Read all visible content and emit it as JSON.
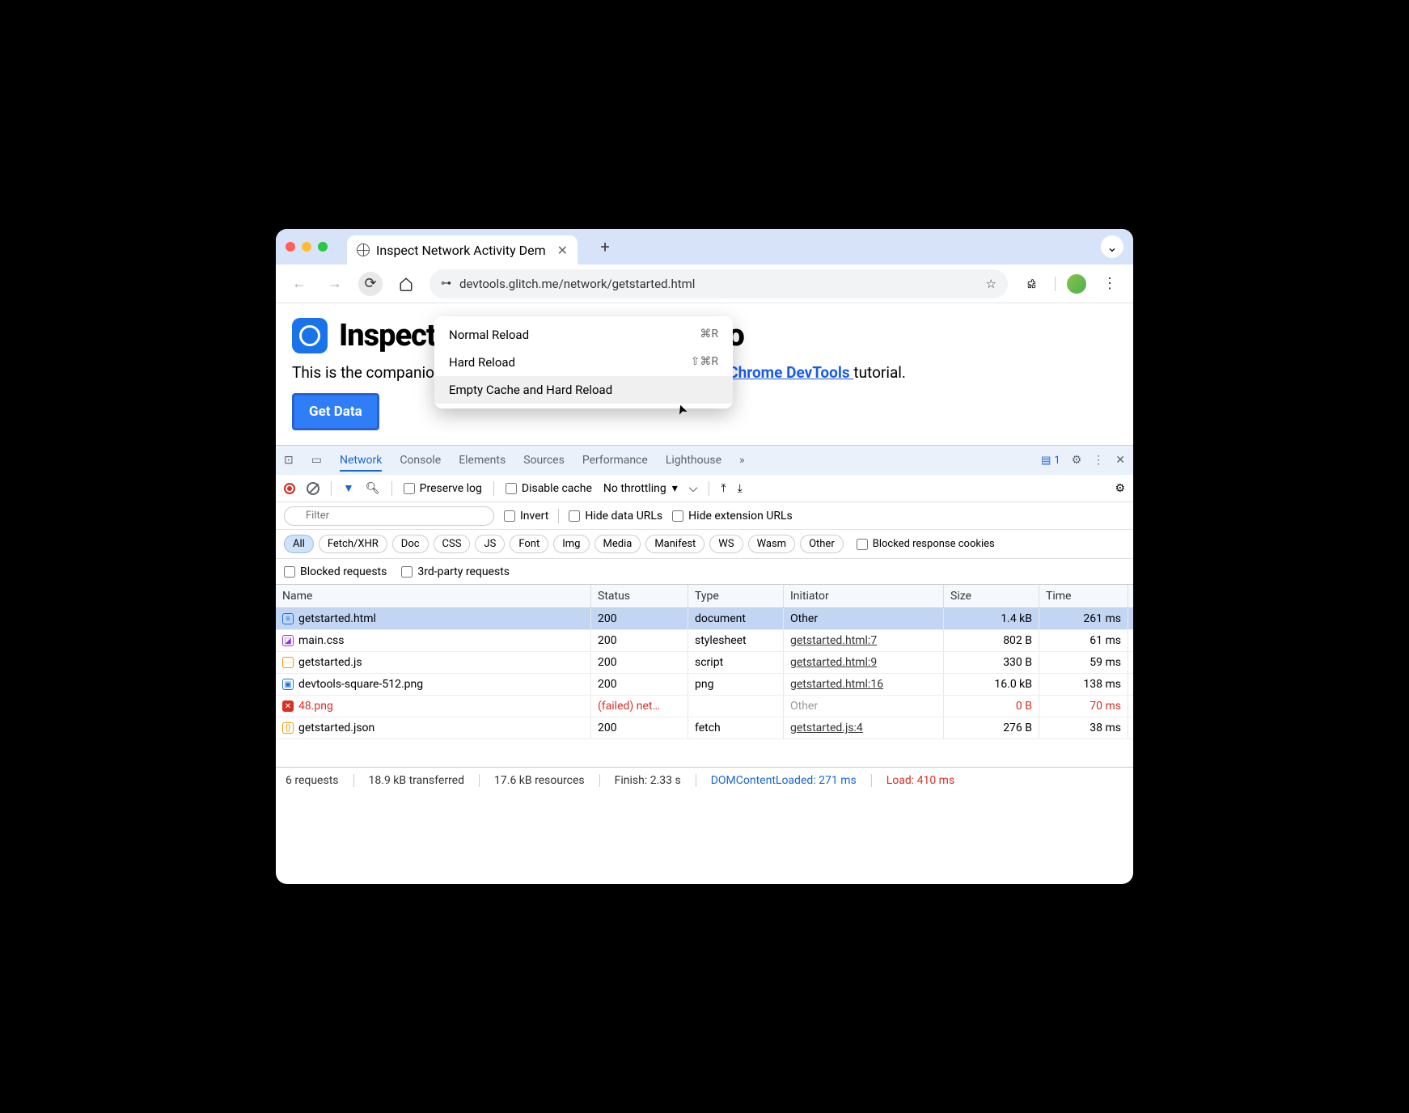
{
  "browser": {
    "tab_title": "Inspect Network Activity Dem",
    "url": "devtools.glitch.me/network/getstarted.html"
  },
  "context_menu": {
    "items": [
      {
        "label": "Normal Reload",
        "shortcut": "⌘R"
      },
      {
        "label": "Hard Reload",
        "shortcut": "⇧⌘R"
      },
      {
        "label": "Empty Cache and Hard Reload",
        "shortcut": ""
      }
    ]
  },
  "page": {
    "heading": "Inspect Network Activity Demo",
    "body_prefix": "This is the companion demo for the ",
    "link_text": "Inspect Network Activity In Chrome DevTools ",
    "body_suffix": "tutorial.",
    "button": "Get Data"
  },
  "devtools": {
    "tabs": [
      "Network",
      "Console",
      "Elements",
      "Sources",
      "Performance",
      "Lighthouse"
    ],
    "active_tab": "Network",
    "issues_count": "1",
    "controls": {
      "preserve_log": "Preserve log",
      "disable_cache": "Disable cache",
      "throttling": "No throttling"
    },
    "filter": {
      "placeholder": "Filter",
      "invert": "Invert",
      "hide_data": "Hide data URLs",
      "hide_ext": "Hide extension URLs"
    },
    "type_pills": [
      "All",
      "Fetch/XHR",
      "Doc",
      "CSS",
      "JS",
      "Font",
      "Img",
      "Media",
      "Manifest",
      "WS",
      "Wasm",
      "Other"
    ],
    "blocked_cookies": "Blocked response cookies",
    "blocked_requests": "Blocked requests",
    "third_party": "3rd-party requests",
    "columns": [
      "Name",
      "Status",
      "Type",
      "Initiator",
      "Size",
      "Time"
    ],
    "rows": [
      {
        "icon_color": "#1a73e8",
        "icon_char": "≡",
        "name": "getstarted.html",
        "status": "200",
        "type": "document",
        "initiator": "Other",
        "initiator_link": false,
        "size": "1.4 kB",
        "time": "261 ms",
        "selected": true,
        "failed": false
      },
      {
        "icon_color": "#9334e6",
        "icon_char": "◪",
        "name": "main.css",
        "status": "200",
        "type": "stylesheet",
        "initiator": "getstarted.html:7",
        "initiator_link": true,
        "size": "802 B",
        "time": "61 ms",
        "selected": false,
        "failed": false
      },
      {
        "icon_color": "#f29900",
        "icon_char": "⋯",
        "name": "getstarted.js",
        "status": "200",
        "type": "script",
        "initiator": "getstarted.html:9",
        "initiator_link": true,
        "size": "330 B",
        "time": "59 ms",
        "selected": false,
        "failed": false
      },
      {
        "icon_color": "#1a73e8",
        "icon_char": "▣",
        "name": "devtools-square-512.png",
        "status": "200",
        "type": "png",
        "initiator": "getstarted.html:16",
        "initiator_link": true,
        "size": "16.0 kB",
        "time": "138 ms",
        "selected": false,
        "failed": false
      },
      {
        "icon_color": "#d93025",
        "icon_char": "✕",
        "name": "48.png",
        "status": "(failed) net…",
        "type": "",
        "initiator": "Other",
        "initiator_link": false,
        "size": "0 B",
        "time": "70 ms",
        "selected": false,
        "failed": true
      },
      {
        "icon_color": "#f29900",
        "icon_char": "{}",
        "name": "getstarted.json",
        "status": "200",
        "type": "fetch",
        "initiator": "getstarted.js:4",
        "initiator_link": true,
        "size": "276 B",
        "time": "38 ms",
        "selected": false,
        "failed": false
      }
    ],
    "status": {
      "requests": "6 requests",
      "transferred": "18.9 kB transferred",
      "resources": "17.6 kB resources",
      "finish": "Finish: 2.33 s",
      "dcl": "DOMContentLoaded: 271 ms",
      "load": "Load: 410 ms"
    }
  }
}
